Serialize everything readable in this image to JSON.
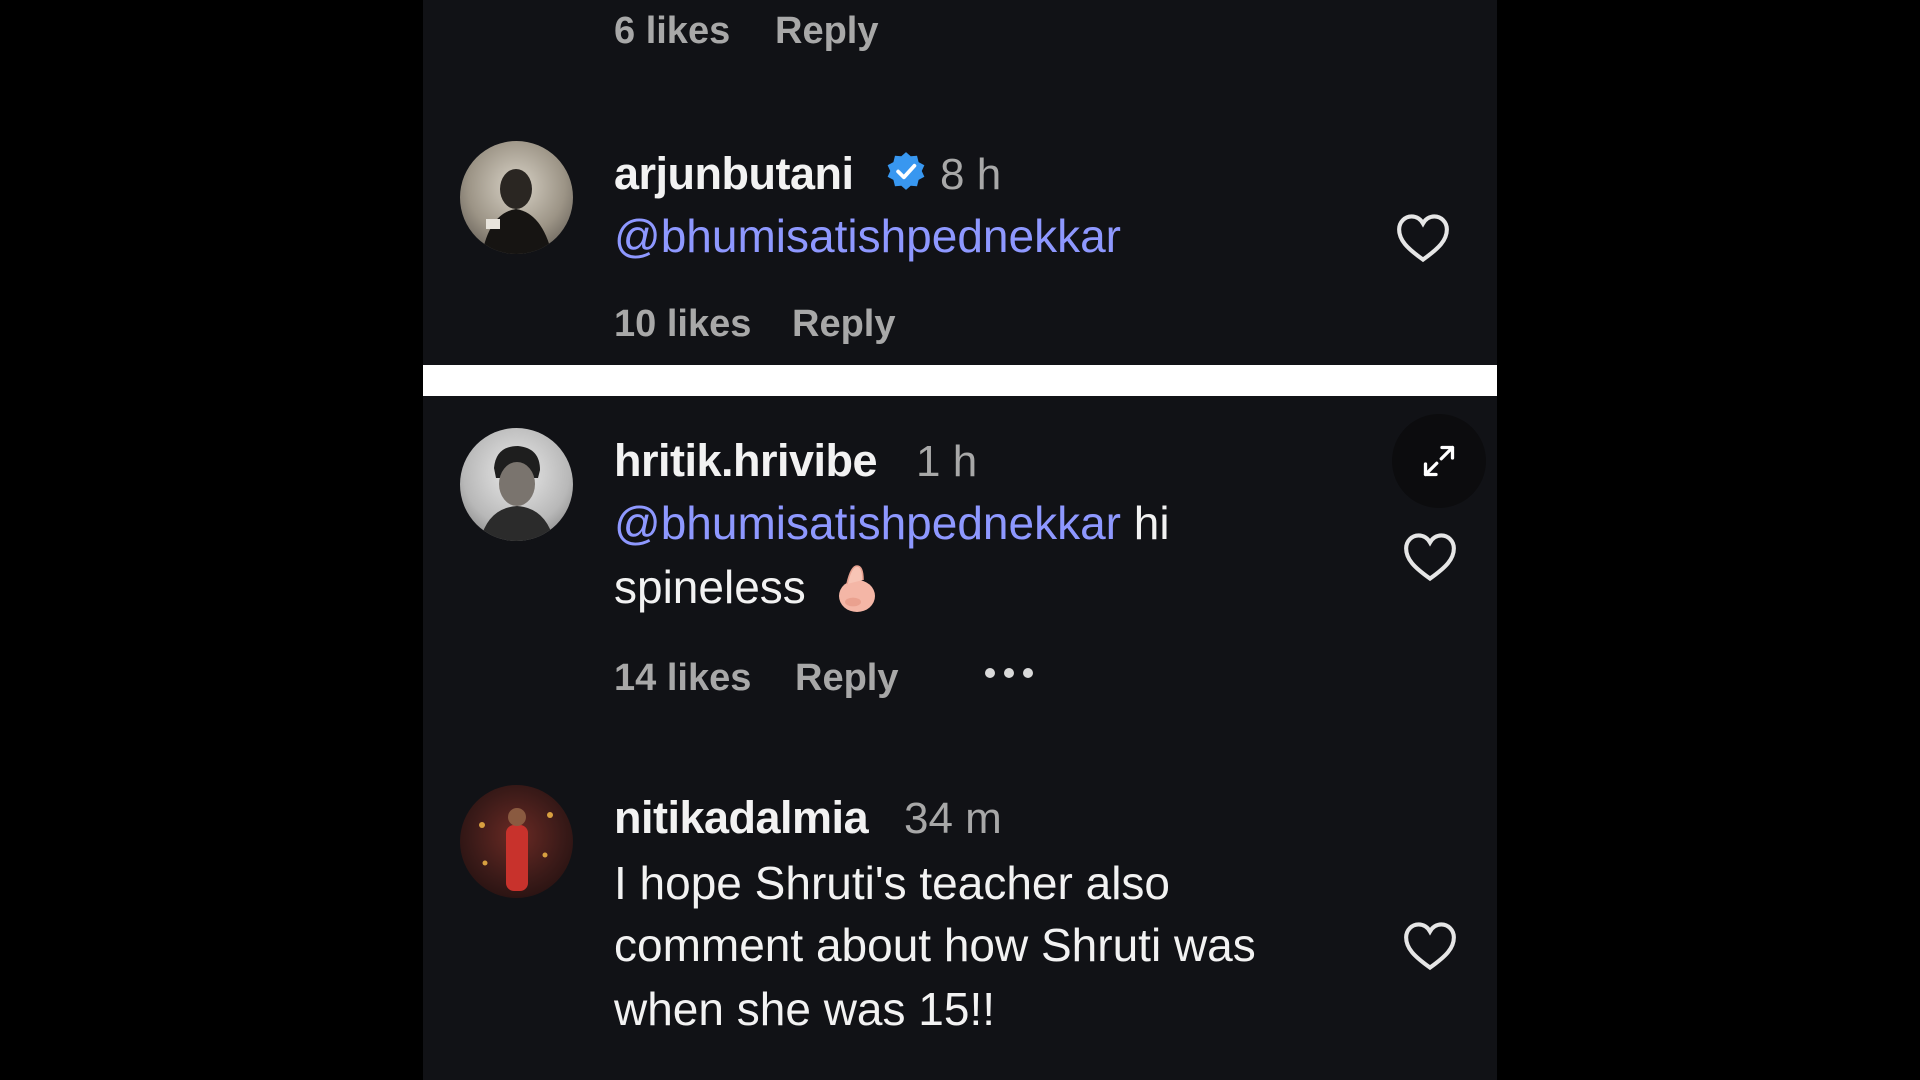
{
  "comments": [
    {
      "likes": "6 likes",
      "reply": "Reply"
    },
    {
      "username": "arjunbutani",
      "verified": true,
      "time": "8 h",
      "mention": "@bhumisatishpednekkar",
      "likes": "10 likes",
      "reply": "Reply"
    },
    {
      "username": "hritik.hrivibe",
      "time": "1 h",
      "mention": "@bhumisatishpednekkar",
      "text_after_mention": " hi",
      "text_line2": "spineless",
      "emoji": "pinching-hand-emoji",
      "likes": "14 likes",
      "reply": "Reply"
    },
    {
      "username": "nitikadalmia",
      "time": "34 m",
      "lines": [
        "I hope Shruti's teacher also",
        "comment about how Shruti was",
        "when she was 15!!"
      ]
    }
  ],
  "icons": {
    "like": "heart-icon",
    "verified": "verified-badge-icon",
    "expand": "expand-icon",
    "more": "more-options-icon"
  },
  "colors": {
    "background": "#111216",
    "mention": "#8e98ff",
    "verified": "#3897f0",
    "secondary_text": "#a8a8a8"
  }
}
